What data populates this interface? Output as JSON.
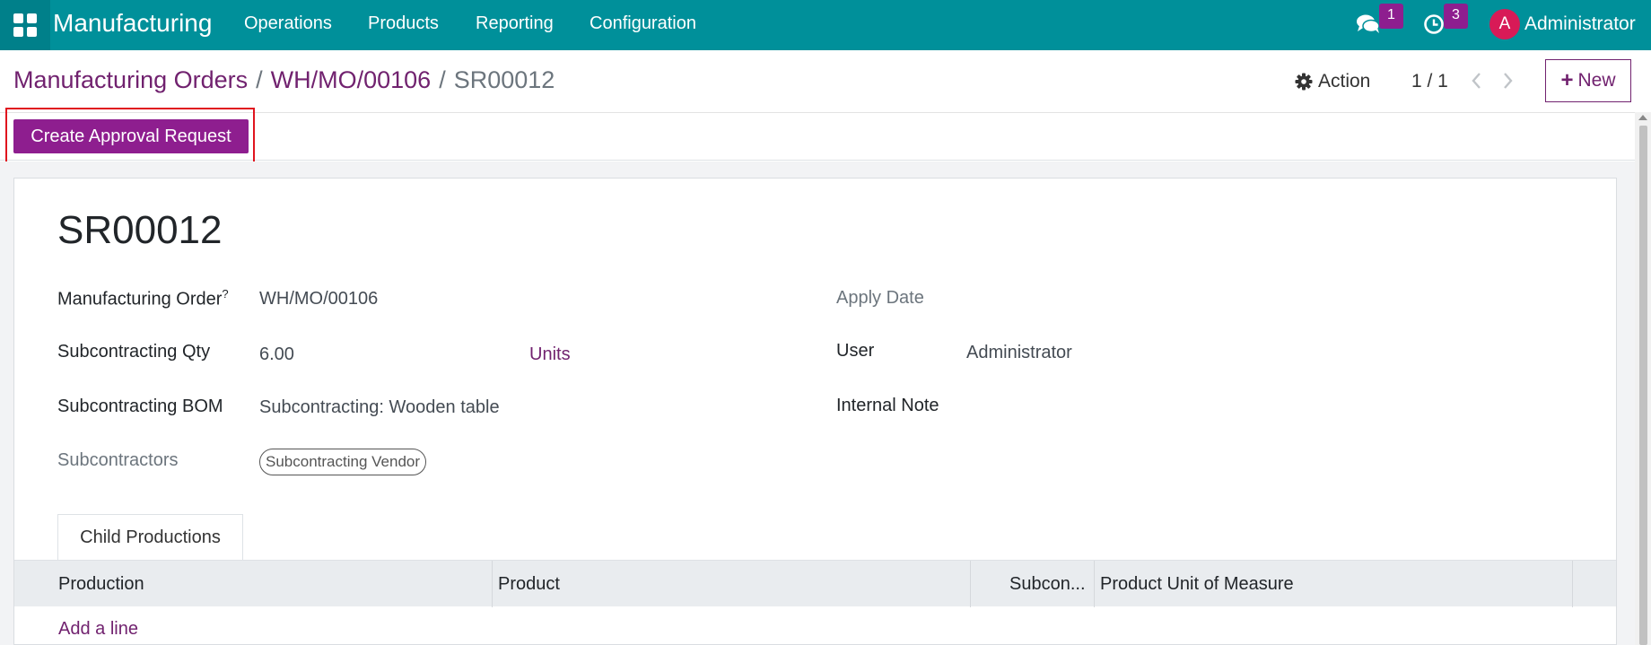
{
  "navbar": {
    "brand": "Manufacturing",
    "menu": [
      "Operations",
      "Products",
      "Reporting",
      "Configuration"
    ],
    "messages_badge": "1",
    "activities_badge": "3",
    "avatar_initial": "A",
    "user": "Administrator",
    "colors": {
      "bar": "#00909a",
      "badge": "#8e1e8f",
      "avatar": "#d81a57"
    }
  },
  "control_panel": {
    "breadcrumb": [
      "Manufacturing Orders",
      "WH/MO/00106",
      "SR00012"
    ],
    "separator": "/",
    "action_label": "Action",
    "pager": "1 / 1",
    "new_label": "New",
    "new_plus": "+"
  },
  "statusbar": {
    "approval_button": "Create Approval Request"
  },
  "form": {
    "title": "SR00012",
    "manufacturing_order_label": "Manufacturing Order",
    "manufacturing_order_help": "?",
    "manufacturing_order_value": "WH/MO/00106",
    "subcontracting_qty_label": "Subcontracting Qty",
    "subcontracting_qty_value": "6.00",
    "uom_value": "Units",
    "subcontracting_bom_label": "Subcontracting BOM",
    "subcontracting_bom_value": "Subcontracting: Wooden table",
    "subcontractors_label": "Subcontractors",
    "subcontractors_tags": [
      "Subcontracting Vendor"
    ],
    "apply_date_label": "Apply Date",
    "apply_date_value": "",
    "user_label": "User",
    "user_value": "Administrator",
    "internal_note_label": "Internal Note",
    "internal_note_value": ""
  },
  "notebook": {
    "tabs": [
      "Child Productions"
    ],
    "columns": [
      "Production",
      "Product",
      "Subcon...",
      "Product Unit of Measure"
    ],
    "add_line": "Add a line"
  },
  "icons": [
    "apps-grid-icon",
    "chat-icon",
    "clock-icon",
    "gear-icon",
    "chevron-left-icon",
    "chevron-right-icon"
  ],
  "accent_color": "#71226f"
}
